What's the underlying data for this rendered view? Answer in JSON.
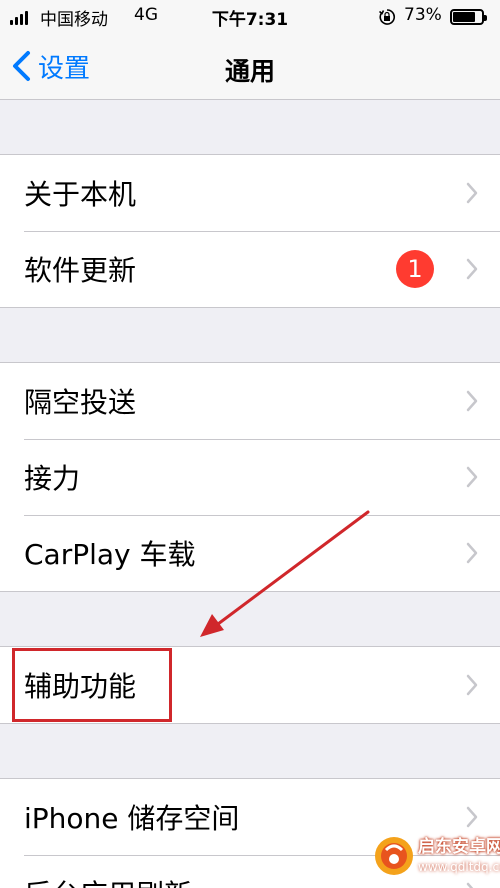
{
  "status_bar": {
    "carrier": "中国移动",
    "network": "4G",
    "time": "下午7:31",
    "battery_percent": "73%",
    "battery_level": 0.73
  },
  "nav": {
    "back_label": "设置",
    "title": "通用"
  },
  "groups": [
    {
      "items": [
        {
          "label": "关于本机"
        },
        {
          "label": "软件更新",
          "badge": "1"
        }
      ]
    },
    {
      "items": [
        {
          "label": "隔空投送"
        },
        {
          "label": "接力"
        },
        {
          "label": "CarPlay 车载"
        }
      ]
    },
    {
      "items": [
        {
          "label": "辅助功能"
        }
      ]
    },
    {
      "items": [
        {
          "label": "iPhone 储存空间"
        },
        {
          "label": "后台应用刷新"
        }
      ]
    }
  ],
  "colors": {
    "accent": "#007aff",
    "badge": "#ff3b30",
    "annotation": "#d0272b",
    "background": "#efeff4"
  },
  "watermark": {
    "name": "启东安卓网",
    "url": "www.qdltdq.com"
  }
}
